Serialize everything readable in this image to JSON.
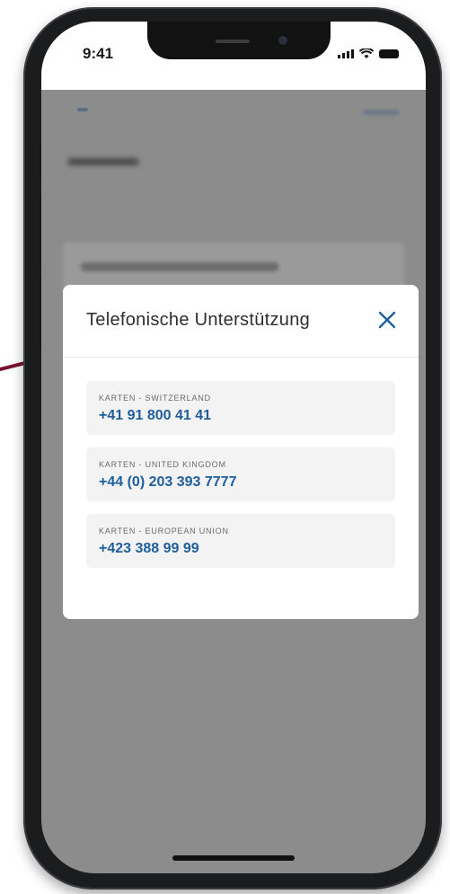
{
  "status_bar": {
    "time": "9:41"
  },
  "modal": {
    "title": "Telefonische Unterstützung",
    "items": [
      {
        "label": "KARTEN - SWITZERLAND",
        "phone": "+41 91 800 41 41"
      },
      {
        "label": "KARTEN - UNITED KINGDOM",
        "phone": "+44 (0) 203 393 7777"
      },
      {
        "label": "KARTEN - EUROPEAN UNION",
        "phone": "+423 388 99 99"
      }
    ]
  },
  "colors": {
    "accent": "#1f5e9c",
    "overlay": "#8c8c8c",
    "connector": "#7a1230"
  }
}
